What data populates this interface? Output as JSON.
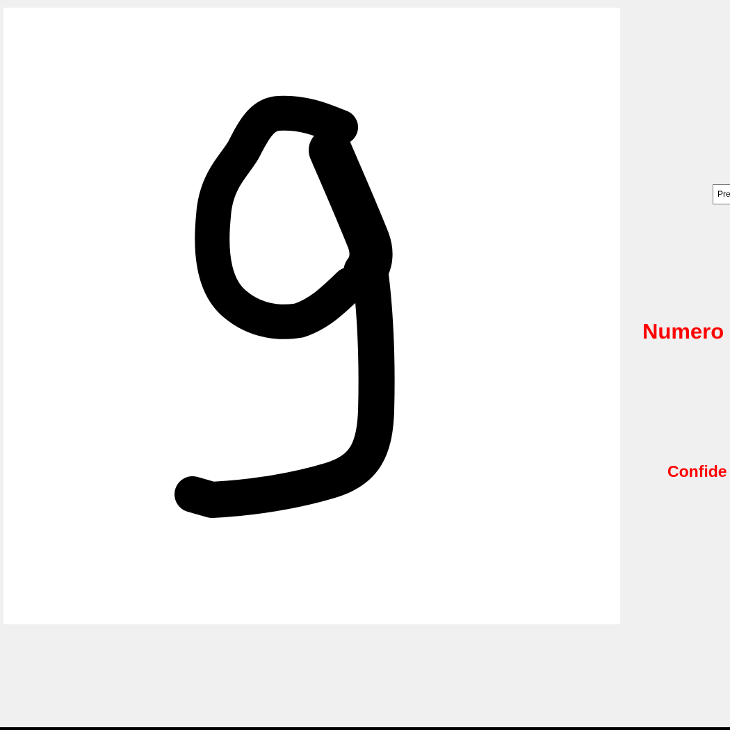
{
  "canvas": {
    "background": "#ffffff",
    "ink_color": "#000000",
    "drawn_digit": "9"
  },
  "controls": {
    "predict_label": "Pre"
  },
  "result": {
    "number_label": "Numero",
    "confidence_label": "Confide",
    "text_color": "#ff0000"
  }
}
